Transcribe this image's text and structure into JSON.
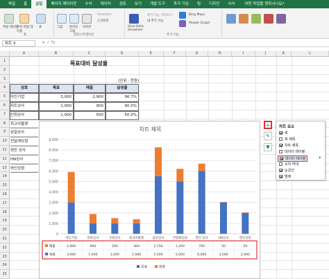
{
  "ribbon": {
    "tabs": [
      "파일",
      "홈",
      "삽입",
      "페이지 레이아웃",
      "수식",
      "데이터",
      "검토",
      "보기",
      "개발 도구",
      "추가 기능",
      "팀",
      "디자인",
      "서식"
    ],
    "active_tab": "삽입",
    "tell_me": "어떤 작업을 원하시나요?",
    "groups": [
      {
        "name": "표",
        "buttons": [
          "피벗 테이블",
          "추천 피벗 테이블",
          "표"
        ]
      },
      {
        "name": "일러스트레이션",
        "buttons": [
          "그림",
          "온라인 그림",
          "아이콘",
          "SmartArt",
          "스크린샷"
        ]
      },
      {
        "name": "추가 기능",
        "buttons": [
          "추가 기능 가져오기",
          "내 추가 기능",
          "Bing Maps",
          "People Graph"
        ]
      },
      {
        "name": "",
        "buttons": [
          "Visio Data Visualizer"
        ]
      }
    ]
  },
  "formula_bar": {
    "name_box": "차트 3"
  },
  "columns": [
    "A",
    "B",
    "C",
    "D",
    "E",
    "F",
    "G",
    "H",
    "I",
    "J",
    "K",
    "L"
  ],
  "rows": [
    "1",
    "2",
    "3",
    "4",
    "5",
    "6",
    "7",
    "8",
    "9",
    "10",
    "11",
    "12",
    "13",
    "14",
    "15",
    "16",
    "17",
    "18",
    "19",
    "20",
    "21",
    "22",
    "23",
    "24",
    "25"
  ],
  "sheet": {
    "title": "목표대비 달성율",
    "unit": "(단위 : 천원)",
    "headers": [
      "상호",
      "목표",
      "매출",
      "달성율"
    ],
    "rows": [
      [
        "아인기업",
        "3,000",
        "2,900",
        "96.7%"
      ],
      [
        "자트상사",
        "1,000",
        "900",
        "90.0%"
      ],
      [
        "신뢰상사",
        "1,000",
        "500",
        "50.0%"
      ]
    ],
    "extra_names": [
      "최고아울렛",
      "삼일상사",
      "진달래상점",
      "영진 상사",
      "HN상사",
      "영신상점"
    ]
  },
  "chart_data": {
    "type": "bar",
    "stacked": true,
    "title": "차트 제목",
    "categories": [
      "아인기업",
      "자트상사",
      "신뢰상사",
      "최고아울렛",
      "삼일상사",
      "진달래상점",
      "영진 상사",
      "HN상사",
      "영신상점"
    ],
    "series": [
      {
        "name": "목표",
        "values": [
          3000,
          1000,
          1000,
          1000,
          5500,
          5000,
          6000,
          3000,
          2000
        ],
        "color": "#4472c4"
      },
      {
        "name": "매출",
        "values": [
          2900,
          900,
          500,
          400,
          2750,
          1200,
          700,
          50,
          50
        ],
        "color": "#ed7d31"
      }
    ],
    "ylim": [
      0,
      9000
    ],
    "yticks": [
      "0",
      "1,000",
      "2,000",
      "3,000",
      "4,000",
      "5,000",
      "6,000",
      "7,000",
      "8,000",
      "9,000"
    ],
    "table_rows": [
      {
        "label": "매출",
        "cells": [
          "2,900",
          "900",
          "500",
          "400",
          "2,750",
          "1,200",
          "700",
          "50",
          "50"
        ]
      },
      {
        "label": "목표",
        "cells": [
          "3,000",
          "1,000",
          "1,000",
          "1,000",
          "5,500",
          "5,000",
          "6,000",
          "3,000",
          "2,000"
        ]
      }
    ],
    "legend": [
      "목표",
      "매출"
    ],
    "highlight_color": "#e03030"
  },
  "chart_elements_panel": {
    "title": "차트 요소",
    "items": [
      {
        "label": "축",
        "checked": true
      },
      {
        "label": "축 제목",
        "checked": false
      },
      {
        "label": "차트 제목",
        "checked": true
      },
      {
        "label": "데이터 레이블",
        "checked": false
      },
      {
        "label": "데이터 테이블",
        "checked": true
      },
      {
        "label": "오차 막대",
        "checked": false
      },
      {
        "label": "눈금선",
        "checked": true
      },
      {
        "label": "범례",
        "checked": true
      }
    ]
  }
}
